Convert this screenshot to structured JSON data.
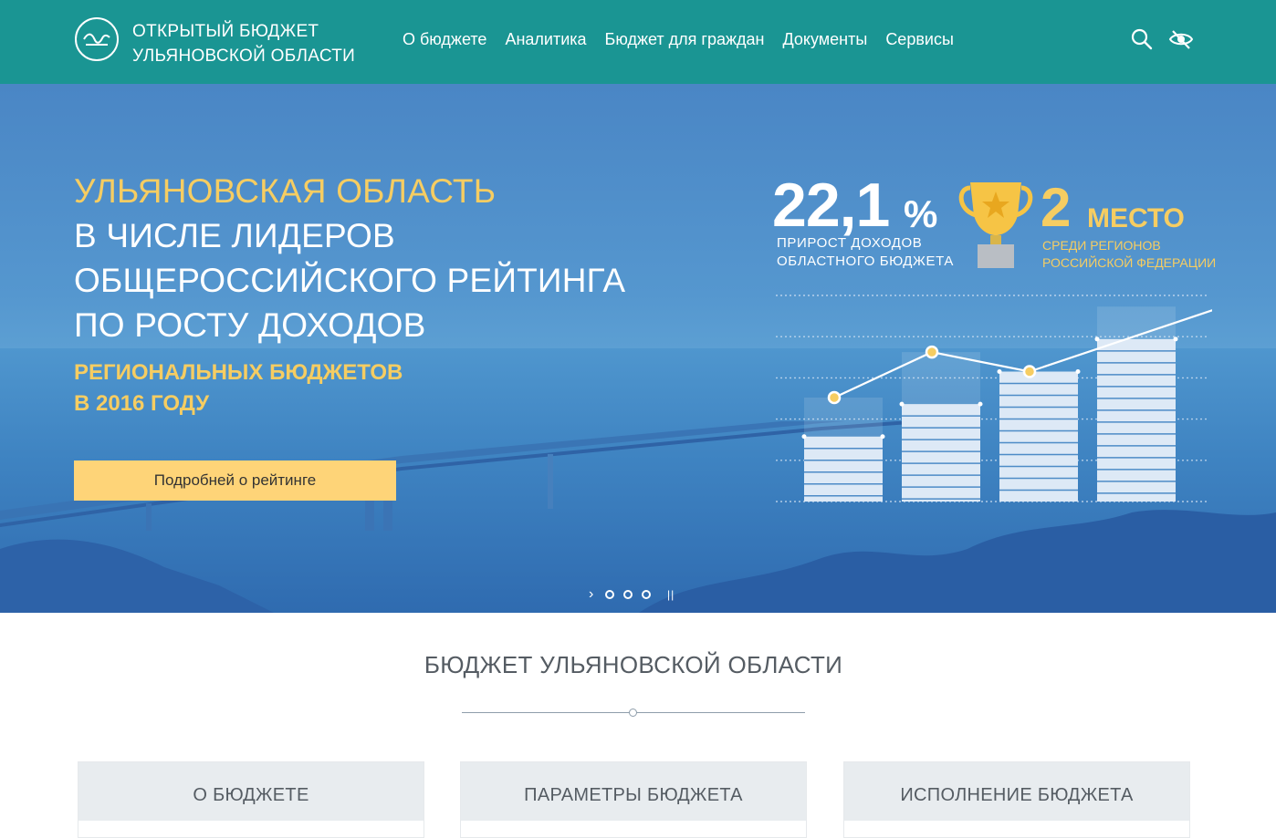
{
  "header": {
    "logo_icon": "logo-icon",
    "title_line1": "Открытый бюджет",
    "title_line2": "Ульяновской области",
    "nav": [
      {
        "label": "О бюджете"
      },
      {
        "label": "Аналитика"
      },
      {
        "label": "Бюджет для граждан"
      },
      {
        "label": "Документы"
      },
      {
        "label": "Сервисы"
      }
    ],
    "icons": [
      "search-icon",
      "eye-accessibility-icon"
    ],
    "bg_color": "#1a9593"
  },
  "hero": {
    "line1": "Ульяновская область",
    "line2": "в числе лидеров",
    "line3": "общероссийского рейтинга",
    "line4": "по росту доходов",
    "sub1": "Региональных бюджетов",
    "sub2": "в 2016 году",
    "button_label": "Подробней о рейтинге",
    "stat_value": "22,1",
    "stat_unit": "%",
    "stat_caption1": "ПРИРОСТ  ДОХОДОВ",
    "stat_caption2": "ОБЛАСТНОГО БЮДЖЕТА",
    "place_number": "2",
    "place_word": "МЕСТО",
    "place_caption1": "СРЕДИ РЕГИОНОВ",
    "place_caption2": "РОССИЙСКОЙ ФЕДЕРАЦИИ",
    "accent_color": "#f6cd62",
    "button_color": "#fed478",
    "slider_dots": 3,
    "slider_active": 0
  },
  "chart_data": {
    "type": "bar",
    "categories": [
      "",
      "",
      "",
      ""
    ],
    "values": [
      2,
      3,
      4,
      5
    ],
    "line_values": [
      3.2,
      4.6,
      4.0,
      6.0
    ],
    "ylim": [
      0,
      6.4
    ],
    "grid": true
  },
  "section": {
    "title": "Бюджет Ульяновской области",
    "cards": [
      {
        "label": "О бюджете"
      },
      {
        "label": "Параметры бюджета"
      },
      {
        "label": "Исполнение бюджета"
      }
    ]
  }
}
